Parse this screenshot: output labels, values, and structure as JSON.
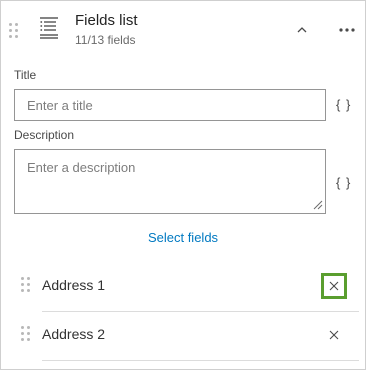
{
  "header": {
    "title": "Fields list",
    "subtitle": "11/13 fields",
    "icon": "list-icon",
    "collapse_icon": "chevron-up-icon",
    "menu_icon": "more-horizontal-icon"
  },
  "title_field": {
    "label": "Title",
    "placeholder": "Enter a title",
    "value": "",
    "expression_button": "{ }"
  },
  "description_field": {
    "label": "Description",
    "placeholder": "Enter a description",
    "value": "",
    "expression_button": "{ }"
  },
  "select_fields_link": "Select fields",
  "fields": [
    {
      "label": "Address 1",
      "remove_icon": "close-icon"
    },
    {
      "label": "Address 2",
      "remove_icon": "close-icon"
    }
  ],
  "colors": {
    "link": "#0079c1",
    "highlight": "#5a9e2f"
  }
}
